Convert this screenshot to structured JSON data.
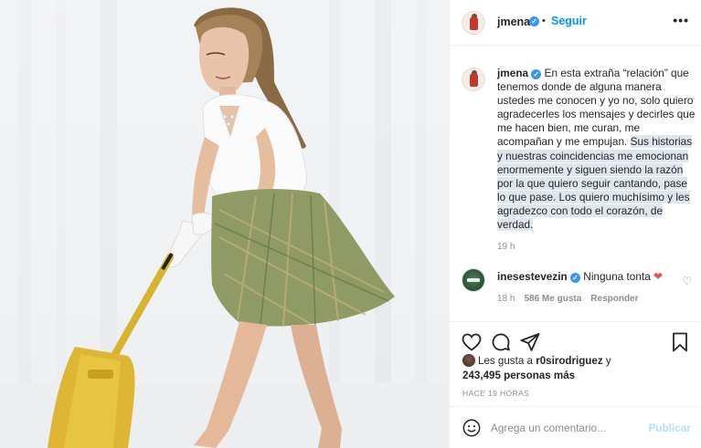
{
  "post": {
    "username": "jmena",
    "follow_label": "Seguir",
    "dot": "•",
    "more_label": "•••",
    "caption": {
      "username": "jmena",
      "text_plain": " En esta extraña “relación” que tenemos donde de alguna manera ustedes me conocen y yo no, solo quiero agradecerles los mensajes y decirles que me hacen bien, me curan, me acompañan y me empujan.",
      "text_highlighted": "Sus historias y nuestras coincidencias me emocionan enormemente y siguen siendo la razón por la que quiero seguir cantando, pase lo que pase. Los quiero muchísimo y les agradezco con todo el corazón, de verdad.",
      "time": "19 h"
    },
    "comment": {
      "username": "inesestevezin",
      "text": "Ninguna tonta",
      "heart": "❤",
      "time": "18 h",
      "likes": "586 Me gusta",
      "reply": "Responder"
    },
    "likes": {
      "prefix": "Les gusta a",
      "user": "r0sirodriguez",
      "conj": "y",
      "count": "243,495 personas más"
    },
    "posted_ago": "HACE 19 HORAS",
    "comment_input": {
      "placeholder": "Agrega un comentario...",
      "post_label": "Publicar"
    }
  },
  "icons": [
    "verified-badge-icon",
    "more-options-icon",
    "heart-icon",
    "comment-icon",
    "share-icon",
    "bookmark-icon",
    "emoji-icon"
  ],
  "colors": {
    "link_blue": "#0095f6",
    "verified_blue": "#3897f0",
    "heart_red": "#ed4956",
    "muted_text": "#8e8e8e",
    "disabled_post": "#b2dffc",
    "highlight": "#dfe6ed"
  }
}
